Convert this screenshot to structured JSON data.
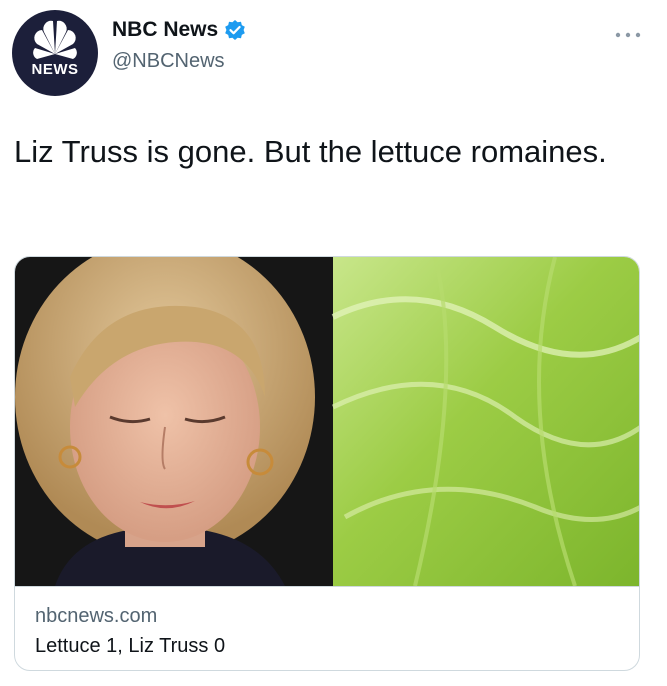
{
  "author": {
    "display_name": "NBC News",
    "handle": "@NBCNews",
    "avatar_text": "NEWS",
    "avatar_bg": "#1c1f3a",
    "verified_color": "#1d9bf0"
  },
  "tweet": {
    "text": "Liz Truss is gone. But the lettuce romaines."
  },
  "card": {
    "domain": "nbcnews.com",
    "title": "Lettuce 1, Liz Truss 0"
  },
  "icons": {
    "more": "more-horizontal-icon",
    "verified": "verified-badge-icon",
    "logo": "nbc-peacock-logo"
  }
}
